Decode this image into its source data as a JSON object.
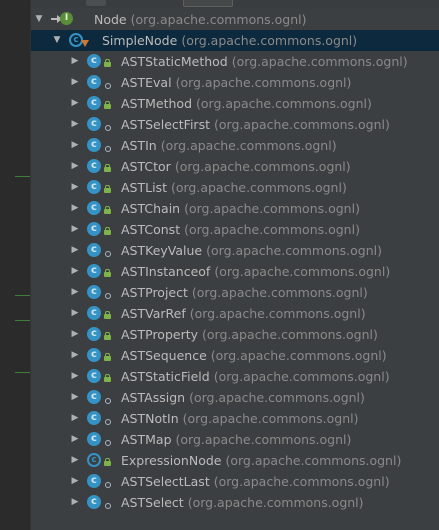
{
  "root": {
    "name": "Node",
    "package": "(org.apache.commons.ognl)"
  },
  "parent": {
    "name": "SimpleNode",
    "package": "(org.apache.commons.ognl)"
  },
  "children": [
    {
      "name": "ASTStaticMethod",
      "package": "(org.apache.commons.ognl)",
      "modifier": "lock-icon"
    },
    {
      "name": "ASTEval",
      "package": "(org.apache.commons.ognl)",
      "modifier": "package-private-icon"
    },
    {
      "name": "ASTMethod",
      "package": "(org.apache.commons.ognl)",
      "modifier": "lock-icon"
    },
    {
      "name": "ASTSelectFirst",
      "package": "(org.apache.commons.ognl)",
      "modifier": "package-private-icon"
    },
    {
      "name": "ASTIn",
      "package": "(org.apache.commons.ognl)",
      "modifier": "package-private-icon"
    },
    {
      "name": "ASTCtor",
      "package": "(org.apache.commons.ognl)",
      "modifier": "lock-icon"
    },
    {
      "name": "ASTList",
      "package": "(org.apache.commons.ognl)",
      "modifier": "lock-icon"
    },
    {
      "name": "ASTChain",
      "package": "(org.apache.commons.ognl)",
      "modifier": "lock-icon"
    },
    {
      "name": "ASTConst",
      "package": "(org.apache.commons.ognl)",
      "modifier": "lock-icon"
    },
    {
      "name": "ASTKeyValue",
      "package": "(org.apache.commons.ognl)",
      "modifier": "package-private-icon"
    },
    {
      "name": "ASTInstanceof",
      "package": "(org.apache.commons.ognl)",
      "modifier": "lock-icon"
    },
    {
      "name": "ASTProject",
      "package": "(org.apache.commons.ognl)",
      "modifier": "package-private-icon"
    },
    {
      "name": "ASTVarRef",
      "package": "(org.apache.commons.ognl)",
      "modifier": "lock-icon"
    },
    {
      "name": "ASTProperty",
      "package": "(org.apache.commons.ognl)",
      "modifier": "lock-icon"
    },
    {
      "name": "ASTSequence",
      "package": "(org.apache.commons.ognl)",
      "modifier": "lock-icon"
    },
    {
      "name": "ASTStaticField",
      "package": "(org.apache.commons.ognl)",
      "modifier": "lock-icon"
    },
    {
      "name": "ASTAssign",
      "package": "(org.apache.commons.ognl)",
      "modifier": "package-private-icon"
    },
    {
      "name": "ASTNotIn",
      "package": "(org.apache.commons.ognl)",
      "modifier": "package-private-icon"
    },
    {
      "name": "ASTMap",
      "package": "(org.apache.commons.ognl)",
      "modifier": "package-private-icon"
    },
    {
      "name": "ExpressionNode",
      "package": "(org.apache.commons.ognl)",
      "modifier": "lock-icon",
      "abstract": true
    },
    {
      "name": "ASTSelectLast",
      "package": "(org.apache.commons.ognl)",
      "modifier": "package-private-icon"
    },
    {
      "name": "ASTSelect",
      "package": "(org.apache.commons.ognl)",
      "modifier": "package-private-icon"
    }
  ],
  "colors": {
    "panel_bg": "#3c3f41",
    "selection": "#0d293e",
    "class_icon": "#3592c4",
    "interface_icon": "#5a8f3a",
    "text": "#bbbbbb",
    "package_text": "#8a8a8a"
  }
}
